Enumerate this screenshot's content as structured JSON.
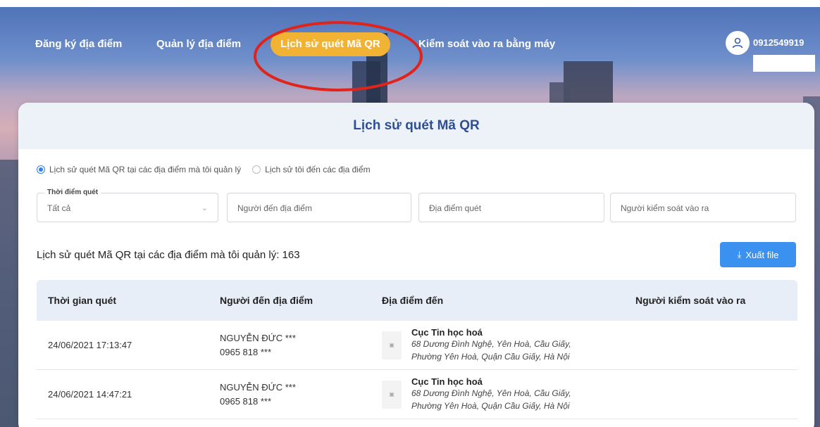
{
  "nav": {
    "items": [
      {
        "label": "Đăng ký địa điểm",
        "active": false
      },
      {
        "label": "Quản lý địa điểm",
        "active": false
      },
      {
        "label": "Lịch sử quét Mã QR",
        "active": true
      },
      {
        "label": "Kiểm soát vào ra bằng máy",
        "active": false
      }
    ],
    "user_phone": "0912549919"
  },
  "page": {
    "title": "Lịch sử quét Mã QR",
    "radio_options": [
      {
        "label": "Lịch sử quét Mã QR tại các địa điểm mà tôi quản lý",
        "selected": true
      },
      {
        "label": "Lịch sử tôi đến các địa điểm",
        "selected": false
      }
    ],
    "filters": {
      "time_label": "Thời điểm quét",
      "time_value": "Tất cả",
      "visitor_placeholder": "Người đến địa điểm",
      "location_placeholder": "Địa điểm quét",
      "controller_placeholder": "Người kiểm soát vào ra"
    },
    "summary": "Lịch sử quét Mã QR tại các địa điểm mà tôi quản lý: 163",
    "export_label": "Xuất file",
    "colors": {
      "accent": "#3b91f0",
      "active_tab": "#f2b233",
      "title": "#2e4f95"
    }
  },
  "table": {
    "headers": [
      "Thời gian quét",
      "Người đến địa điểm",
      "Địa điểm đến",
      "Người kiểm soát vào ra"
    ],
    "rows": [
      {
        "time": "24/06/2021 17:13:47",
        "visitor_name": "NGUYỄN ĐỨC ***",
        "visitor_phone": "0965 818 ***",
        "location_name": "Cục Tin học hoá",
        "location_addr1": "68 Dương Đình Nghệ, Yên Hoà, Cầu Giấy,",
        "location_addr2": "Phường Yên Hoà, Quận Cầu Giấy, Hà Nội",
        "controller": ""
      },
      {
        "time": "24/06/2021 14:47:21",
        "visitor_name": "NGUYỄN ĐỨC ***",
        "visitor_phone": "0965 818 ***",
        "location_name": "Cục Tin học hoá",
        "location_addr1": "68 Dương Đình Nghệ, Yên Hoà, Cầu Giấy,",
        "location_addr2": "Phường Yên Hoà, Quận Cầu Giấy, Hà Nội",
        "controller": ""
      }
    ]
  }
}
